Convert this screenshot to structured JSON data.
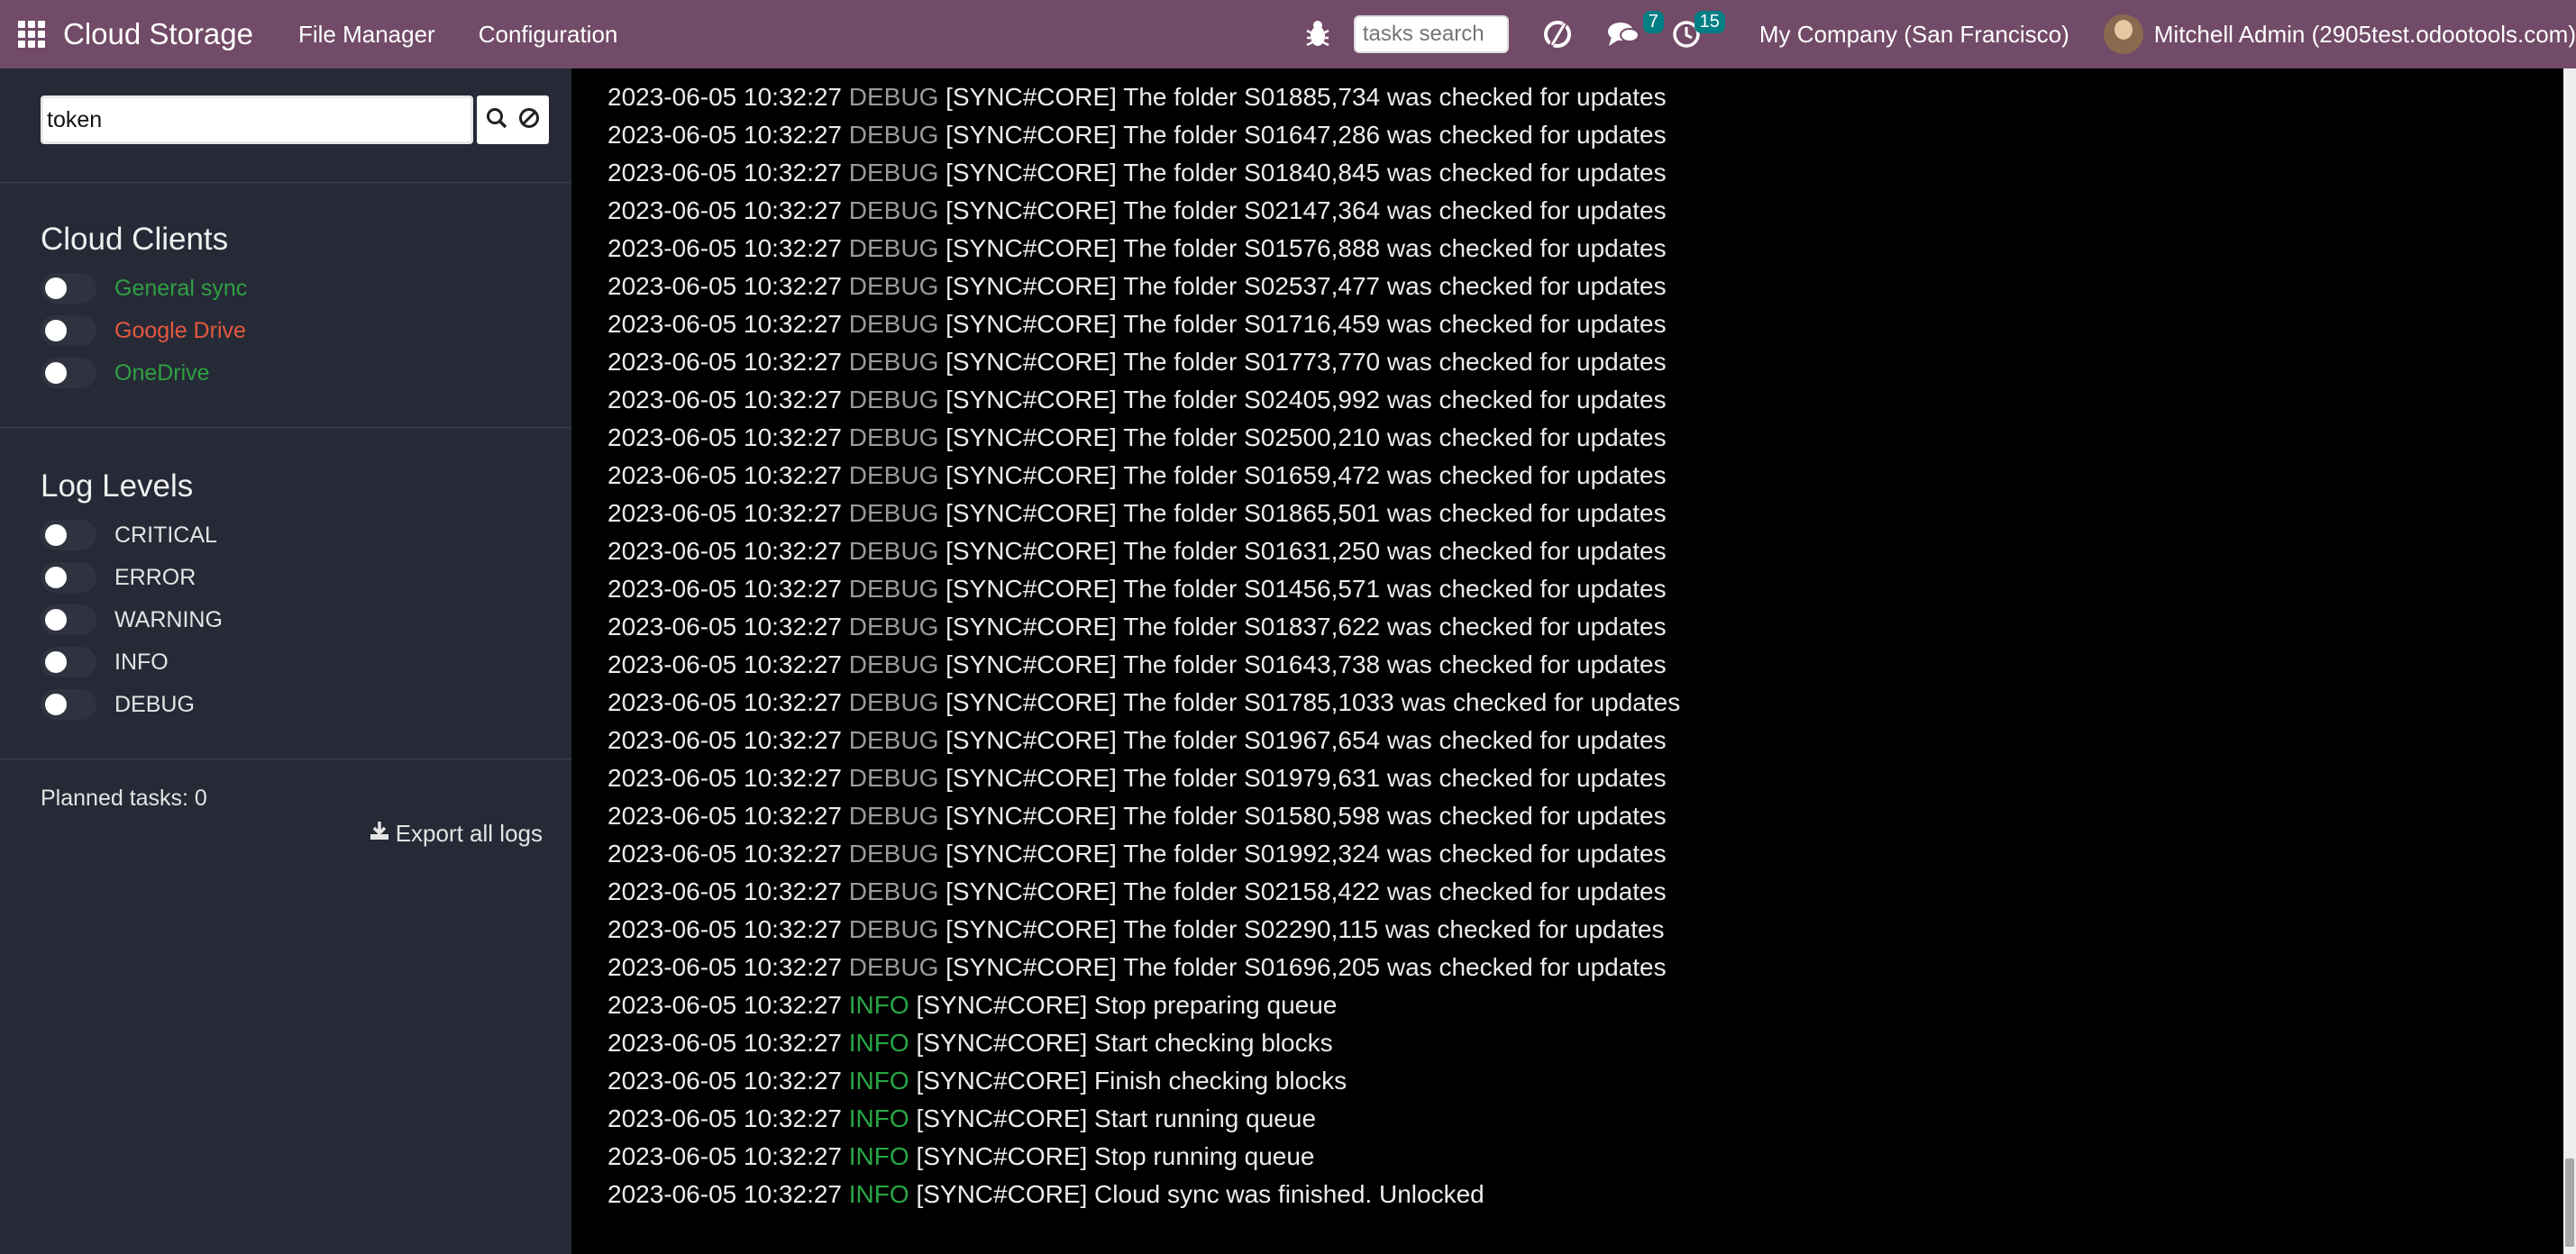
{
  "navbar": {
    "brand": "Cloud Storage",
    "menu": [
      "File Manager",
      "Configuration"
    ],
    "search_placeholder": "tasks search",
    "messages_count": "7",
    "activities_count": "15",
    "company": "My Company (San Francisco)",
    "user": "Mitchell Admin (2905test.odootools.com)",
    "color": "#714b67"
  },
  "sidebar": {
    "search_value": "token",
    "cloud_clients_title": "Cloud Clients",
    "cloud_clients": [
      {
        "label": "General sync",
        "color": "#2ea043"
      },
      {
        "label": "Google Drive",
        "color": "#e4583f"
      },
      {
        "label": "OneDrive",
        "color": "#2ea043"
      }
    ],
    "log_levels_title": "Log Levels",
    "log_levels": [
      "CRITICAL",
      "ERROR",
      "WARNING",
      "INFO",
      "DEBUG"
    ],
    "planned_tasks": "Planned tasks: 0",
    "export_label": "Export all logs"
  },
  "logs": [
    {
      "ts": "2023-06-05 10:32:27",
      "level": "DEBUG",
      "msg": "[SYNC#CORE] The folder S01885,734 was checked for updates"
    },
    {
      "ts": "2023-06-05 10:32:27",
      "level": "DEBUG",
      "msg": "[SYNC#CORE] The folder S01647,286 was checked for updates"
    },
    {
      "ts": "2023-06-05 10:32:27",
      "level": "DEBUG",
      "msg": "[SYNC#CORE] The folder S01840,845 was checked for updates"
    },
    {
      "ts": "2023-06-05 10:32:27",
      "level": "DEBUG",
      "msg": "[SYNC#CORE] The folder S02147,364 was checked for updates"
    },
    {
      "ts": "2023-06-05 10:32:27",
      "level": "DEBUG",
      "msg": "[SYNC#CORE] The folder S01576,888 was checked for updates"
    },
    {
      "ts": "2023-06-05 10:32:27",
      "level": "DEBUG",
      "msg": "[SYNC#CORE] The folder S02537,477 was checked for updates"
    },
    {
      "ts": "2023-06-05 10:32:27",
      "level": "DEBUG",
      "msg": "[SYNC#CORE] The folder S01716,459 was checked for updates"
    },
    {
      "ts": "2023-06-05 10:32:27",
      "level": "DEBUG",
      "msg": "[SYNC#CORE] The folder S01773,770 was checked for updates"
    },
    {
      "ts": "2023-06-05 10:32:27",
      "level": "DEBUG",
      "msg": "[SYNC#CORE] The folder S02405,992 was checked for updates"
    },
    {
      "ts": "2023-06-05 10:32:27",
      "level": "DEBUG",
      "msg": "[SYNC#CORE] The folder S02500,210 was checked for updates"
    },
    {
      "ts": "2023-06-05 10:32:27",
      "level": "DEBUG",
      "msg": "[SYNC#CORE] The folder S01659,472 was checked for updates"
    },
    {
      "ts": "2023-06-05 10:32:27",
      "level": "DEBUG",
      "msg": "[SYNC#CORE] The folder S01865,501 was checked for updates"
    },
    {
      "ts": "2023-06-05 10:32:27",
      "level": "DEBUG",
      "msg": "[SYNC#CORE] The folder S01631,250 was checked for updates"
    },
    {
      "ts": "2023-06-05 10:32:27",
      "level": "DEBUG",
      "msg": "[SYNC#CORE] The folder S01456,571 was checked for updates"
    },
    {
      "ts": "2023-06-05 10:32:27",
      "level": "DEBUG",
      "msg": "[SYNC#CORE] The folder S01837,622 was checked for updates"
    },
    {
      "ts": "2023-06-05 10:32:27",
      "level": "DEBUG",
      "msg": "[SYNC#CORE] The folder S01643,738 was checked for updates"
    },
    {
      "ts": "2023-06-05 10:32:27",
      "level": "DEBUG",
      "msg": "[SYNC#CORE] The folder S01785,1033 was checked for updates"
    },
    {
      "ts": "2023-06-05 10:32:27",
      "level": "DEBUG",
      "msg": "[SYNC#CORE] The folder S01967,654 was checked for updates"
    },
    {
      "ts": "2023-06-05 10:32:27",
      "level": "DEBUG",
      "msg": "[SYNC#CORE] The folder S01979,631 was checked for updates"
    },
    {
      "ts": "2023-06-05 10:32:27",
      "level": "DEBUG",
      "msg": "[SYNC#CORE] The folder S01580,598 was checked for updates"
    },
    {
      "ts": "2023-06-05 10:32:27",
      "level": "DEBUG",
      "msg": "[SYNC#CORE] The folder S01992,324 was checked for updates"
    },
    {
      "ts": "2023-06-05 10:32:27",
      "level": "DEBUG",
      "msg": "[SYNC#CORE] The folder S02158,422 was checked for updates"
    },
    {
      "ts": "2023-06-05 10:32:27",
      "level": "DEBUG",
      "msg": "[SYNC#CORE] The folder S02290,115 was checked for updates"
    },
    {
      "ts": "2023-06-05 10:32:27",
      "level": "DEBUG",
      "msg": "[SYNC#CORE] The folder S01696,205 was checked for updates"
    },
    {
      "ts": "2023-06-05 10:32:27",
      "level": "INFO",
      "msg": "[SYNC#CORE] Stop preparing queue"
    },
    {
      "ts": "2023-06-05 10:32:27",
      "level": "INFO",
      "msg": "[SYNC#CORE] Start checking blocks"
    },
    {
      "ts": "2023-06-05 10:32:27",
      "level": "INFO",
      "msg": "[SYNC#CORE] Finish checking blocks"
    },
    {
      "ts": "2023-06-05 10:32:27",
      "level": "INFO",
      "msg": "[SYNC#CORE] Start running queue"
    },
    {
      "ts": "2023-06-05 10:32:27",
      "level": "INFO",
      "msg": "[SYNC#CORE] Stop running queue"
    },
    {
      "ts": "2023-06-05 10:32:27",
      "level": "INFO",
      "msg": "[SYNC#CORE] Cloud sync was finished. Unlocked"
    }
  ]
}
